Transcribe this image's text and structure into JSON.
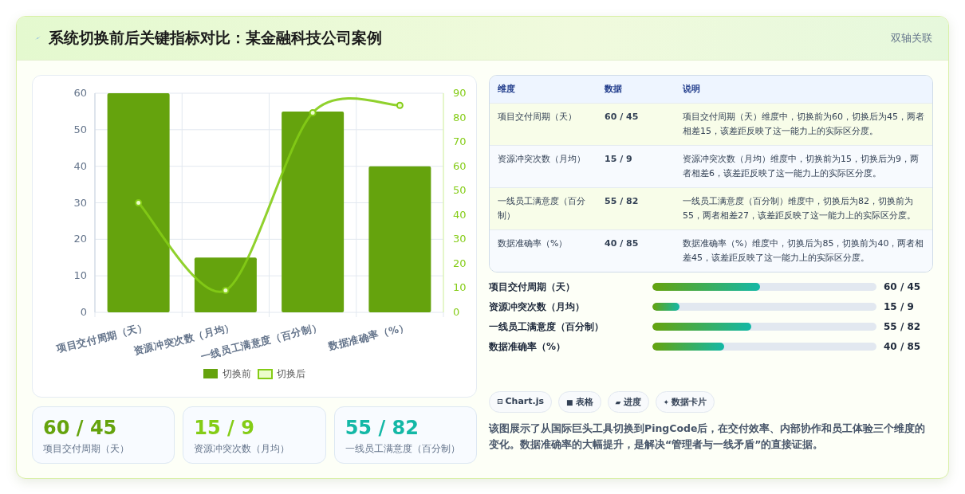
{
  "header": {
    "title": "系统切换前后关键指标对比：某金融科技公司案例",
    "badge": "双轴关联"
  },
  "chart": {
    "chart_data": {
      "type": "bar",
      "categories": [
        "项目交付周期（天）",
        "资源冲突次数（月均）",
        "一线员工满意度（百分制）",
        "数据准确率（%）"
      ],
      "series": [
        {
          "name": "切换前",
          "color": "#65a30d",
          "type": "bar",
          "values": [
            60,
            15,
            55,
            40
          ]
        },
        {
          "name": "切换后",
          "color": "#84cc16",
          "type": "line",
          "axis": "y2",
          "marker": "circle",
          "values": [
            45,
            9,
            82,
            85
          ]
        }
      ],
      "grid": true,
      "legend": true,
      "ylim": [
        0,
        60
      ],
      "yticks": [
        0,
        10,
        20,
        30,
        40,
        50,
        60
      ],
      "y2lim": [
        0,
        90
      ],
      "y2ticks": [
        0,
        10,
        20,
        30,
        40,
        50,
        60,
        70,
        80,
        90
      ]
    }
  },
  "stat_cards": [
    {
      "value": "60 / 45",
      "label": "项目交付周期（天）",
      "color": "#65a30d"
    },
    {
      "value": "15 / 9",
      "label": "资源冲突次数（月均）",
      "color": "#84cc16"
    },
    {
      "value": "55 / 82",
      "label": "一线员工满意度（百分制）",
      "color": "#14b8a6"
    }
  ],
  "table": {
    "columns": [
      "维度",
      "数据",
      "说明"
    ],
    "rows": [
      [
        "项目交付周期（天）",
        "60 / 45",
        "项目交付周期（天）维度中，切换前为60，切换后为45，两者相差15，该差距反映了这一能力上的实际区分度。"
      ],
      [
        "资源冲突次数（月均）",
        "15 / 9",
        "资源冲突次数（月均）维度中，切换前为15，切换后为9，两者相差6，该差距反映了这一能力上的实际区分度。"
      ],
      [
        "一线员工满意度（百分制）",
        "55 / 82",
        "一线员工满意度（百分制）维度中，切换后为82，切换前为55，两者相差27，该差距反映了这一能力上的实际区分度。"
      ],
      [
        "数据准确率（%）",
        "40 / 85",
        "数据准确率（%）维度中，切换后为85，切换前为40，两者相差45，该差距反映了这一能力上的实际区分度。"
      ]
    ]
  },
  "progress": [
    {
      "label": "项目交付周期（天）",
      "level": 0.48,
      "reading": "60 / 45"
    },
    {
      "label": "资源冲突次数（月均）",
      "level": 0.12,
      "reading": "15 / 9"
    },
    {
      "label": "一线员工满意度（百分制）",
      "level": 0.44,
      "reading": "55 / 82"
    },
    {
      "label": "数据准确率（%）",
      "level": 0.32,
      "reading": "40 / 85"
    }
  ],
  "chips": [
    {
      "icon": "⊟",
      "label": "Chart.js"
    },
    {
      "icon": "■",
      "label": "表格"
    },
    {
      "icon": "▰",
      "label": "进度"
    },
    {
      "icon": "✦",
      "label": "数据卡片"
    }
  ],
  "note": "该图展示了从国际巨头工具切换到PingCode后，在交付效率、内部协作和员工体验三个维度的变化。数据准确率的大幅提升，是解决“管理者与一线矛盾”的直接证据。"
}
